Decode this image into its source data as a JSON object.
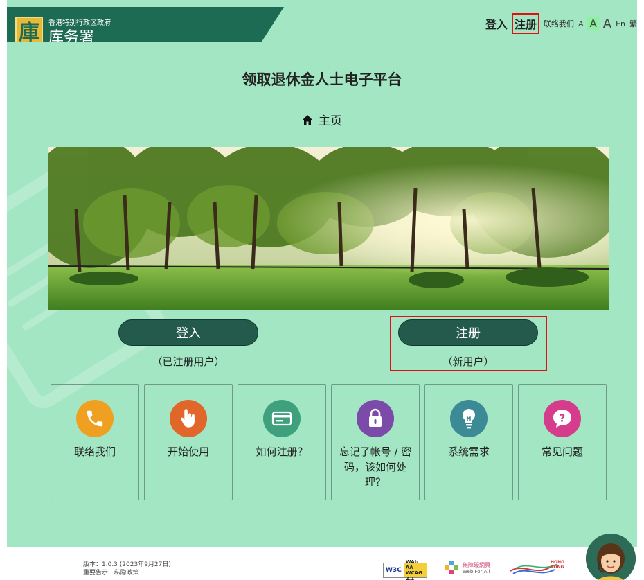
{
  "header": {
    "gov_name": "香港特别行政区政府",
    "dept_name": "库务署",
    "logo_char": "庫",
    "nav": {
      "login": "登入",
      "register": "注册",
      "contact": "联络我们",
      "font_small": "A",
      "font_medium": "A",
      "font_large": "A",
      "english": "En",
      "traditional": "繁"
    }
  },
  "main": {
    "title": "领取退休金人士电子平台",
    "breadcrumb": "主页",
    "login_button": "登入",
    "login_sub": "（已注册用户）",
    "register_button": "注册",
    "register_sub": "（新用户）",
    "tiles": [
      {
        "label": "联络我们",
        "icon": "phone-icon",
        "color": "#f0a020"
      },
      {
        "label": "开始使用",
        "icon": "hand-pointer-icon",
        "color": "#e0662a"
      },
      {
        "label": "如何注册？",
        "icon": "card-icon",
        "color": "#3fa07e"
      },
      {
        "label": "忘记了帐号 / 密码，该如何处理？",
        "icon": "lock-icon",
        "color": "#7c4aa8"
      },
      {
        "label": "系统需求",
        "icon": "lightbulb-icon",
        "color": "#3b8a96"
      },
      {
        "label": "常见问题",
        "icon": "question-icon",
        "color": "#d63c8c"
      }
    ]
  },
  "footer": {
    "version": "版本：1.0.3 (2023年9月27日)",
    "notice": "重要告示",
    "privacy": "私隐政策",
    "badge_w3c": "W3C",
    "badge_wai": "WAI-AA",
    "badge_wcag": "WCAG 2.1",
    "badge_wfa_zh": "無障礙網頁",
    "badge_wfa_en": "Web For All",
    "badge_hk": "HONG KONG"
  },
  "colors": {
    "page_bg": "#a3e6c3",
    "brand": "#1e6b53",
    "button": "#245a4c",
    "highlight": "#e01010"
  }
}
